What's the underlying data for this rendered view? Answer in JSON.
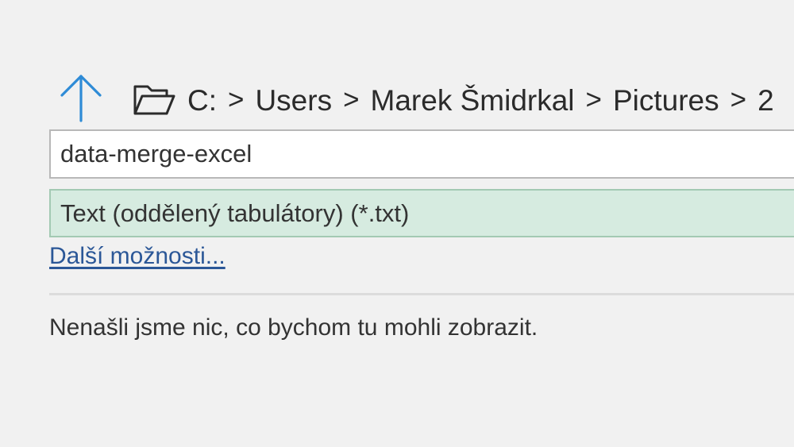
{
  "navigation": {
    "up_icon": "arrow-up-icon",
    "folder_icon": "open-folder-icon",
    "breadcrumb": [
      "C:",
      "Users",
      "Marek Šmidrkal",
      "Pictures",
      "2"
    ],
    "separator": ">"
  },
  "filename_field": {
    "value": "data-merge-excel"
  },
  "filetype": {
    "selected": "Text (oddělený tabulátory) (*.txt)"
  },
  "more_options_link": "Další možnosti...",
  "empty_message": "Nenašli jsme nic, co bychom tu mohli zobrazit.",
  "colors": {
    "accent": "#2e8bd6",
    "link": "#2b5797",
    "selected_bg": "#d6ebe0",
    "background": "#f1f1f1"
  }
}
